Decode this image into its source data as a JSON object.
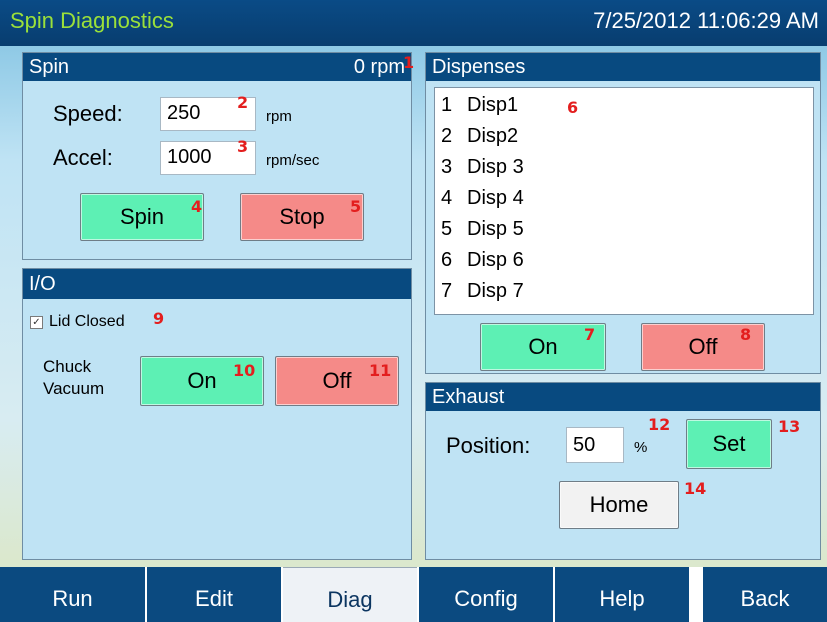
{
  "app": {
    "title": "Spin Diagnostics",
    "datetime": "7/25/2012 11:06:29 AM"
  },
  "spin": {
    "header": "Spin",
    "rpm_readout": "0 rpm",
    "speed_label": "Speed:",
    "speed_value": "250",
    "speed_unit": "rpm",
    "accel_label": "Accel:",
    "accel_value": "1000",
    "accel_unit": "rpm/sec",
    "spin_button": "Spin",
    "stop_button": "Stop"
  },
  "io": {
    "header": "I/O",
    "lid_closed_label": "Lid Closed",
    "lid_closed_checked": true,
    "chuck_vacuum_label_line1": "Chuck",
    "chuck_vacuum_label_line2": "Vacuum",
    "on_button": "On",
    "off_button": "Off"
  },
  "dispenses": {
    "header": "Dispenses",
    "items": [
      {
        "num": "1",
        "name": "Disp1"
      },
      {
        "num": "2",
        "name": "Disp2"
      },
      {
        "num": "3",
        "name": "Disp 3"
      },
      {
        "num": "4",
        "name": "Disp 4"
      },
      {
        "num": "5",
        "name": "Disp 5"
      },
      {
        "num": "6",
        "name": "Disp 6"
      },
      {
        "num": "7",
        "name": "Disp 7"
      }
    ],
    "on_button": "On",
    "off_button": "Off"
  },
  "exhaust": {
    "header": "Exhaust",
    "position_label": "Position:",
    "position_value": "50",
    "position_unit": "%",
    "set_button": "Set",
    "home_button": "Home"
  },
  "annotations": [
    "1",
    "2",
    "3",
    "4",
    "5",
    "6",
    "7",
    "8",
    "9",
    "10",
    "11",
    "12",
    "13",
    "14"
  ],
  "tabs": [
    {
      "label": "Run",
      "active": false
    },
    {
      "label": "Edit",
      "active": false
    },
    {
      "label": "Diag",
      "active": true
    },
    {
      "label": "Config",
      "active": false
    },
    {
      "label": "Help",
      "active": false
    },
    {
      "label": "Back",
      "active": false
    }
  ],
  "colors": {
    "header_bg": "#084a80",
    "title_text": "#9be03a",
    "panel_bg": "#bfe3f4",
    "button_green": "#5df0b4",
    "button_red": "#f58a88",
    "annotation_red": "#e31e1e"
  }
}
